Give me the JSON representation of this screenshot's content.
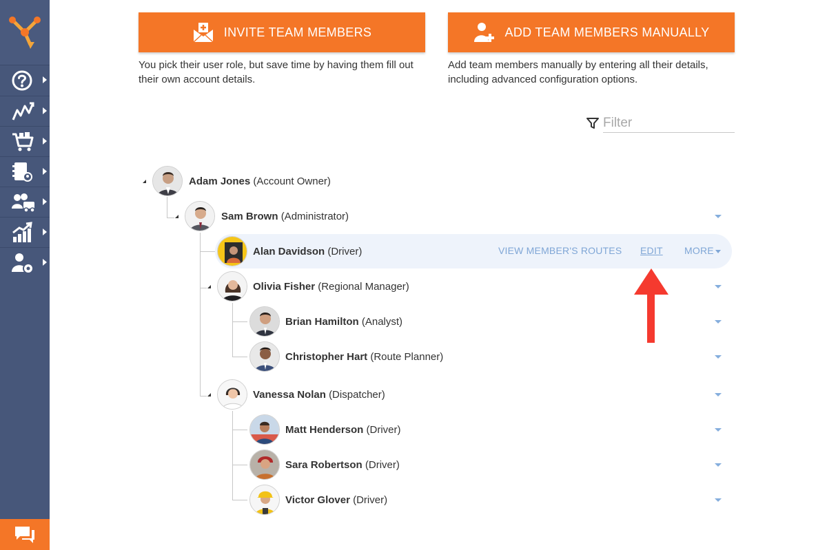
{
  "sidebar": {
    "logo_icon": "routing-logo-icon",
    "items": [
      {
        "icon": "help-icon"
      },
      {
        "icon": "routes-icon"
      },
      {
        "icon": "orders-cart-icon"
      },
      {
        "icon": "address-book-icon"
      },
      {
        "icon": "team-vehicles-icon"
      },
      {
        "icon": "analytics-icon"
      },
      {
        "icon": "user-settings-icon"
      }
    ],
    "chat_icon": "chat-icon",
    "accent": "#f47627"
  },
  "actions": {
    "invite": {
      "label": "INVITE TEAM MEMBERS",
      "description": "You pick their user role, but save time by having them fill out their own account details."
    },
    "add": {
      "label": "ADD TEAM MEMBERS MANUALLY",
      "description": "Add team members manually by entering all their details, including advanced configuration options."
    }
  },
  "filter": {
    "placeholder": "Filter",
    "value": ""
  },
  "tree": {
    "members": [
      {
        "name": "Adam Jones",
        "role": "(Account Owner)"
      },
      {
        "name": "Sam Brown",
        "role": "(Administrator)"
      },
      {
        "name": "Alan Davidson",
        "role": "(Driver)"
      },
      {
        "name": "Olivia Fisher",
        "role": "(Regional Manager)"
      },
      {
        "name": "Brian Hamilton",
        "role": "(Analyst)"
      },
      {
        "name": "Christopher Hart",
        "role": "(Route Planner)"
      },
      {
        "name": "Vanessa Nolan",
        "role": "(Dispatcher)"
      },
      {
        "name": "Matt Henderson",
        "role": "(Driver)"
      },
      {
        "name": "Sara Robertson",
        "role": "(Driver)"
      },
      {
        "name": "Victor Glover",
        "role": "(Driver)"
      }
    ],
    "row_actions": {
      "view_routes": "VIEW MEMBER'S ROUTES",
      "edit": "EDIT",
      "more": "MORE"
    }
  },
  "colors": {
    "orange": "#f47627",
    "sidebar": "#47577a",
    "link": "#7fa6d6",
    "highlight": "#eef3fb",
    "arrow": "#f53a2f"
  }
}
